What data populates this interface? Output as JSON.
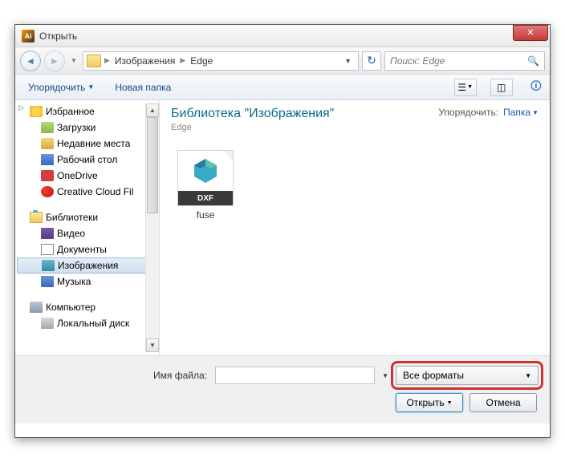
{
  "titlebar": {
    "app_icon": "Ai",
    "title": "Открыть"
  },
  "nav": {
    "path": [
      "Изображения",
      "Edge"
    ],
    "search_placeholder": "Поиск: Edge"
  },
  "toolbar": {
    "organize": "Упорядочить",
    "new_folder": "Новая папка"
  },
  "sidebar": {
    "favorites": {
      "label": "Избранное",
      "items": [
        "Загрузки",
        "Недавние места",
        "Рабочий стол",
        "OneDrive",
        "Creative Cloud Fil"
      ]
    },
    "libraries": {
      "label": "Библиотеки",
      "items": [
        "Видео",
        "Документы",
        "Изображения",
        "Музыка"
      ],
      "selected_index": 2
    },
    "computer": {
      "label": "Компьютер",
      "items": [
        "Локальный диск"
      ]
    }
  },
  "content": {
    "title": "Библиотека \"Изображения\"",
    "subtitle": "Edge",
    "sort_label": "Упорядочить:",
    "sort_value": "Папка",
    "files": [
      {
        "name": "fuse",
        "badge": "DXF"
      }
    ]
  },
  "footer": {
    "filename_label": "Имя файла:",
    "filename_value": "",
    "format_value": "Все форматы",
    "open": "Открыть",
    "cancel": "Отмена"
  }
}
